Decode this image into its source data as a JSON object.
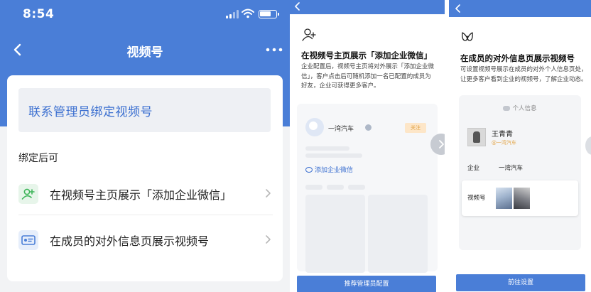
{
  "panel1": {
    "status": {
      "time": "8:54"
    },
    "nav": {
      "title": "视频号"
    },
    "bind_button": "联系管理员绑定视频号",
    "section_label": "绑定后可",
    "rows": [
      {
        "label": "在视频号主页展示「添加企业微信」",
        "icon": "add-user-icon"
      },
      {
        "label": "在成员的对外信息页展示视频号",
        "icon": "id-card-icon"
      }
    ]
  },
  "panel2": {
    "title": "在视频号主页展示「添加企业微信」",
    "description": "企业配置后，视频号主页将对外展示「添加企业微信」，客户点击后可随机添加一名已配置的成员为好友，企业可获得更多客户。",
    "mock": {
      "account_name": "一湾汽车",
      "follow_tag": "关注",
      "link": "添加企业微信"
    },
    "button": "推荐管理员配置"
  },
  "panel3": {
    "title": "在成员的对外信息页展示视频号",
    "description": "可设置视频号展示在成员的对外个人信息页处，让更多客户看到企业的视频号，了解企业动态。",
    "mock": {
      "header": "个人信息",
      "name": "王青青",
      "company_tag": "@一湾汽车",
      "enterprise_label": "企业",
      "enterprise_value": "一湾汽车",
      "channel_label": "视频号"
    },
    "button": "前往设置"
  },
  "colors": {
    "primary_blue": "#4a7ed7",
    "link_blue": "#3b6fd0",
    "background_gray": "#f2f3f5",
    "tag_orange": "#e3a64a"
  }
}
